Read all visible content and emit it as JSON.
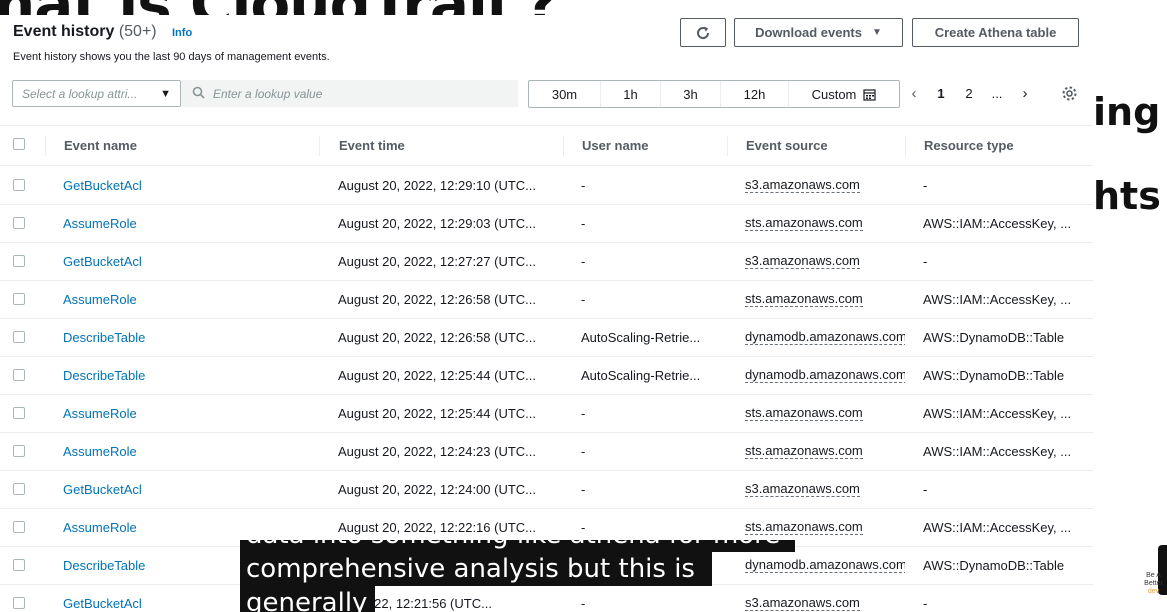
{
  "background": {
    "title": "hat is CloudTrail ?",
    "right_words": [
      "ing",
      "hts"
    ],
    "logo": {
      "line1": "Be A",
      "line2": "Better",
      "line3": "dev"
    }
  },
  "header": {
    "title": "Event history",
    "count": "(50+)",
    "info": "Info",
    "description": "Event history shows you the last 90 days of management events."
  },
  "buttons": {
    "refresh_icon": "refresh-icon",
    "download": "Download events",
    "athena": "Create Athena table"
  },
  "filter": {
    "select_placeholder": "Select a lookup attri...",
    "search_placeholder": "Enter a lookup value"
  },
  "time_range": [
    "30m",
    "1h",
    "3h",
    "12h",
    "Custom"
  ],
  "pagination": {
    "pages": [
      "1",
      "2",
      "..."
    ],
    "current": "1"
  },
  "table": {
    "columns": [
      "Event name",
      "Event time",
      "User name",
      "Event source",
      "Resource type"
    ],
    "rows": [
      {
        "name": "GetBucketAcl",
        "time": "August 20, 2022, 12:29:10 (UTC...",
        "user": "-",
        "source": "s3.amazonaws.com",
        "resource": "-"
      },
      {
        "name": "AssumeRole",
        "time": "August 20, 2022, 12:29:03 (UTC...",
        "user": "-",
        "source": "sts.amazonaws.com",
        "resource": "AWS::IAM::AccessKey, ..."
      },
      {
        "name": "GetBucketAcl",
        "time": "August 20, 2022, 12:27:27 (UTC...",
        "user": "-",
        "source": "s3.amazonaws.com",
        "resource": "-"
      },
      {
        "name": "AssumeRole",
        "time": "August 20, 2022, 12:26:58 (UTC...",
        "user": "-",
        "source": "sts.amazonaws.com",
        "resource": "AWS::IAM::AccessKey, ..."
      },
      {
        "name": "DescribeTable",
        "time": "August 20, 2022, 12:26:58 (UTC...",
        "user": "AutoScaling-Retrie...",
        "source": "dynamodb.amazonaws.com",
        "resource": "AWS::DynamoDB::Table"
      },
      {
        "name": "DescribeTable",
        "time": "August 20, 2022, 12:25:44 (UTC...",
        "user": "AutoScaling-Retrie...",
        "source": "dynamodb.amazonaws.com",
        "resource": "AWS::DynamoDB::Table"
      },
      {
        "name": "AssumeRole",
        "time": "August 20, 2022, 12:25:44 (UTC...",
        "user": "-",
        "source": "sts.amazonaws.com",
        "resource": "AWS::IAM::AccessKey, ..."
      },
      {
        "name": "AssumeRole",
        "time": "August 20, 2022, 12:24:23 (UTC...",
        "user": "-",
        "source": "sts.amazonaws.com",
        "resource": "AWS::IAM::AccessKey, ..."
      },
      {
        "name": "GetBucketAcl",
        "time": "August 20, 2022, 12:24:00 (UTC...",
        "user": "-",
        "source": "s3.amazonaws.com",
        "resource": "-"
      },
      {
        "name": "AssumeRole",
        "time": "August 20, 2022, 12:22:16 (UTC...",
        "user": "-",
        "source": "sts.amazonaws.com",
        "resource": "AWS::IAM::AccessKey, ..."
      },
      {
        "name": "DescribeTable",
        "time": "",
        "user": "",
        "source": "dynamodb.amazonaws.com",
        "resource": "AWS::DynamoDB::Table"
      },
      {
        "name": "GetBucketAcl",
        "time": "20, 2022, 12:21:56 (UTC...",
        "user": "-",
        "source": "s3.amazonaws.com",
        "resource": "-"
      }
    ]
  },
  "subtitles": {
    "line1": "data into something like athena for more",
    "line2": "comprehensive analysis but this is",
    "line3": "generally"
  },
  "colors": {
    "link": "#0073bb",
    "text": "#16191f",
    "muted": "#545b64",
    "border": "#eaeded"
  }
}
